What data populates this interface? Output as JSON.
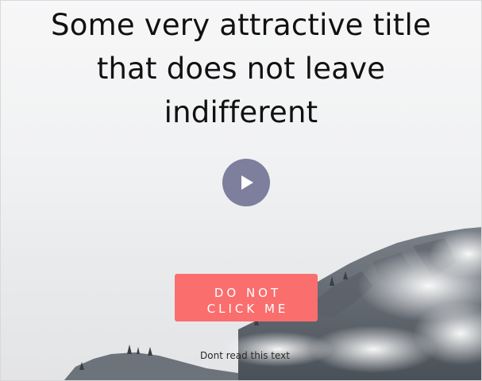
{
  "hero": {
    "title_lines": [
      "Some very attractive title",
      "that does not leave",
      "indifferent"
    ],
    "play_icon": "play-icon",
    "play_color": "#7d7f9c",
    "cta_lines": [
      "DO NOT",
      "CLICK ME"
    ],
    "cta_color": "#fa6e6e",
    "footnote": "Dont read this text"
  }
}
